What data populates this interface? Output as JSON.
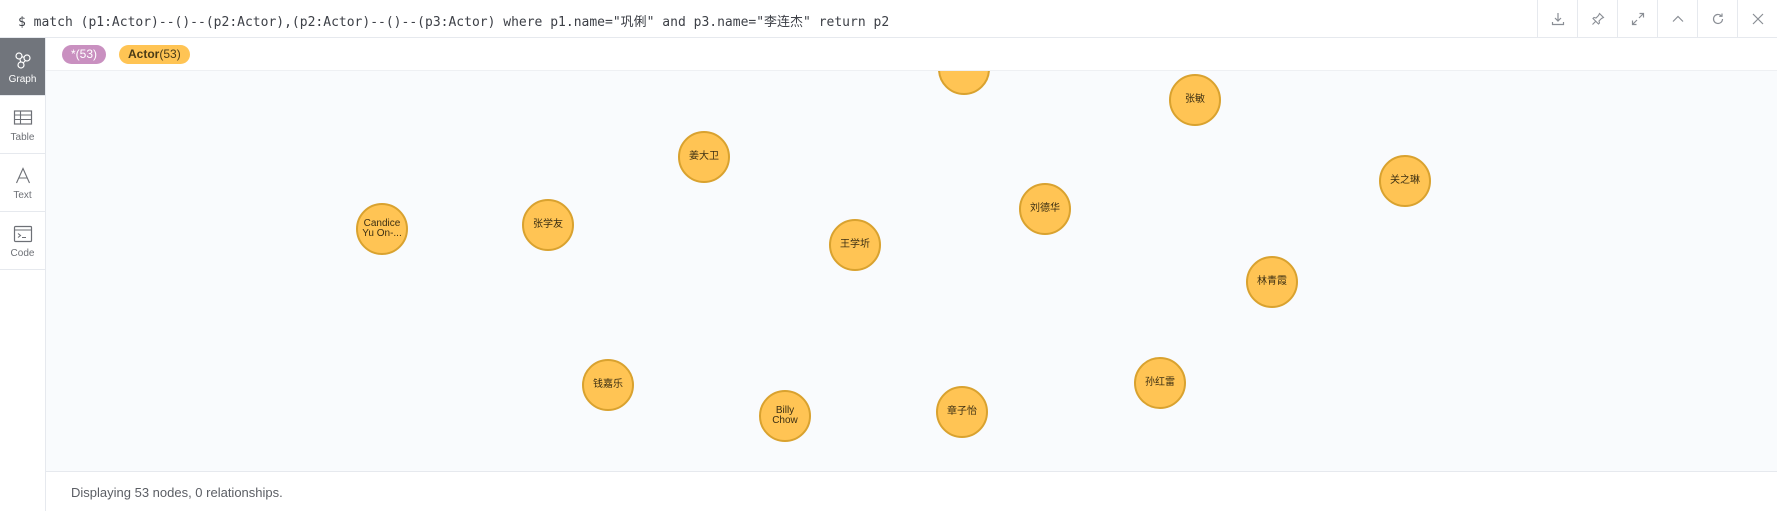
{
  "query": {
    "text": "$ match (p1:Actor)--()--(p2:Actor),(p2:Actor)--()--(p3:Actor) where p1.name=\"巩俐\" and p3.name=\"李连杰\" return p2"
  },
  "toolbar": {
    "buttons": [
      {
        "name": "download-icon"
      },
      {
        "name": "pin-icon"
      },
      {
        "name": "expand-icon"
      },
      {
        "name": "collapse-up-icon"
      },
      {
        "name": "rerun-icon"
      },
      {
        "name": "close-icon"
      }
    ]
  },
  "sidebar": {
    "items": [
      {
        "label": "Graph",
        "icon": "graph-icon",
        "active": true
      },
      {
        "label": "Table",
        "icon": "table-icon",
        "active": false
      },
      {
        "label": "Text",
        "icon": "text-icon",
        "active": false
      },
      {
        "label": "Code",
        "icon": "code-icon",
        "active": false
      }
    ]
  },
  "legend": {
    "all_label": "*(53)",
    "actor_label": "Actor",
    "actor_count": "(53)"
  },
  "graph": {
    "node_color": "#ffc454",
    "node_border": "#d9a22f",
    "nodes": [
      {
        "name": ""
      },
      {
        "name": "张敏"
      },
      {
        "name": "姜大卫"
      },
      {
        "name": "关之琳"
      },
      {
        "name": "刘德华"
      },
      {
        "name": "Candice Yu On-..."
      },
      {
        "name": "张学友"
      },
      {
        "name": "王学圻"
      },
      {
        "name": "林青霞"
      },
      {
        "name": "钱嘉乐"
      },
      {
        "name": "孙红雷"
      },
      {
        "name": "Billy Chow"
      },
      {
        "name": "章子怡"
      }
    ]
  },
  "status": {
    "text": "Displaying 53 nodes, 0 relationships."
  }
}
